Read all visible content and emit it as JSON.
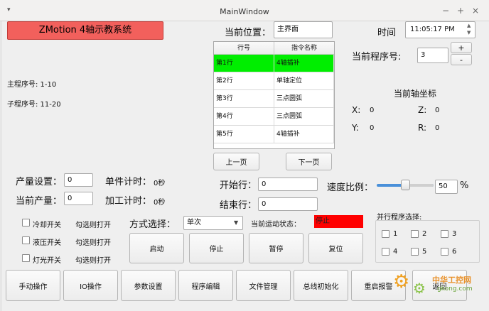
{
  "window": {
    "title": "MainWindow",
    "menu_icon": "▾",
    "minimize": "−",
    "maximize": "+",
    "close": "×"
  },
  "app": {
    "title_button": "ZMotion    4轴示教系统"
  },
  "main_program": "主程序号: 1-10",
  "sub_program": "子程序号: 11-20",
  "current_position": {
    "label": "当前位置：",
    "value": "主界面"
  },
  "time": {
    "label": "时间",
    "value": "11:05:17 PM"
  },
  "program_table": {
    "headers": [
      "行号",
      "指令名称"
    ],
    "rows": [
      {
        "line": "第1行",
        "cmd": "4轴插补",
        "selected": true
      },
      {
        "line": "第2行",
        "cmd": "单轴定位",
        "selected": false
      },
      {
        "line": "第3行",
        "cmd": "三点圆弧",
        "selected": false
      },
      {
        "line": "第4行",
        "cmd": "三点圆弧",
        "selected": false
      },
      {
        "line": "第5行",
        "cmd": "4轴插补",
        "selected": false
      }
    ],
    "prev_page": "上一页",
    "next_page": "下一页"
  },
  "current_program": {
    "label": "当前程序号:",
    "value": "3",
    "plus": "+",
    "minus": "-"
  },
  "axis_coords": {
    "title": "当前轴坐标",
    "x_label": "X:",
    "x_value": "0",
    "y_label": "Y:",
    "y_value": "0",
    "z_label": "Z:",
    "z_value": "0",
    "r_label": "R:",
    "r_value": "0"
  },
  "production": {
    "set_label": "产量设置：",
    "set_value": "0",
    "current_label": "当前产量：",
    "current_value": "0",
    "piece_time_label": "单件计时：",
    "piece_time_value": "0秒",
    "process_time_label": "加工计时：",
    "process_time_value": "0秒"
  },
  "rows": {
    "start_label": "开始行：",
    "start_value": "0",
    "end_label": "结束行：",
    "end_value": "0"
  },
  "speed": {
    "label": "速度比例：",
    "value": "50",
    "unit": "%",
    "level_percent": 50
  },
  "switches": [
    {
      "label": "冷却开关",
      "hint": "勾选则打开"
    },
    {
      "label": "液压开关",
      "hint": "勾选则打开"
    },
    {
      "label": "灯光开关",
      "hint": "勾选则打开"
    }
  ],
  "mode": {
    "label": "方式选择：",
    "value": "单次"
  },
  "motion_status": {
    "label": "当前运动状态：",
    "value": "停止",
    "color": "#ff0000"
  },
  "controls": {
    "start": "启动",
    "stop": "停止",
    "pause": "暂停",
    "reset": "复位"
  },
  "parallel": {
    "title": "并行程序选择:",
    "options": [
      "1",
      "2",
      "3",
      "4",
      "5",
      "6"
    ]
  },
  "bottom_buttons": [
    "手动操作",
    "IO操作",
    "参数设置",
    "程序编辑",
    "文件管理",
    "总线初始化",
    "重启报警",
    "返回"
  ],
  "watermark": {
    "text": "中华工控网",
    "sub": "gkong.com"
  },
  "colors": {
    "accent_red": "#f2605c",
    "selected_row": "#00ee00",
    "slider": "#4a90d9"
  }
}
